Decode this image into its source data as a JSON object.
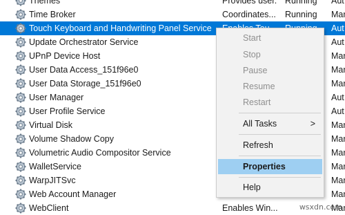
{
  "services": [
    {
      "name": "Themes",
      "description": "Provides user...",
      "status": "Running",
      "startup": "Aut"
    },
    {
      "name": "Time Broker",
      "description": "Coordinates...",
      "status": "Running",
      "startup": "Mar"
    },
    {
      "name": "Touch Keyboard and Handwriting Panel Service",
      "description": "Enables Tou...",
      "status": "Running",
      "startup": "Aut",
      "selected": true
    },
    {
      "name": "Update Orchestrator Service",
      "description": "",
      "status": "",
      "startup": "Aut"
    },
    {
      "name": "UPnP Device Host",
      "description": "",
      "status": "",
      "startup": "Mar"
    },
    {
      "name": "User Data Access_151f96e0",
      "description": "",
      "status": "",
      "startup": "Mar"
    },
    {
      "name": "User Data Storage_151f96e0",
      "description": "",
      "status": "",
      "startup": "Mar"
    },
    {
      "name": "User Manager",
      "description": "",
      "status": "",
      "startup": "Aut"
    },
    {
      "name": "User Profile Service",
      "description": "",
      "status": "",
      "startup": "Aut"
    },
    {
      "name": "Virtual Disk",
      "description": "",
      "status": "",
      "startup": "Mar"
    },
    {
      "name": "Volume Shadow Copy",
      "description": "",
      "status": "",
      "startup": "Mar"
    },
    {
      "name": "Volumetric Audio Compositor Service",
      "description": "",
      "status": "",
      "startup": "Mar"
    },
    {
      "name": "WalletService",
      "description": "",
      "status": "",
      "startup": "Mar"
    },
    {
      "name": "WarpJITSvc",
      "description": "",
      "status": "",
      "startup": "Mar"
    },
    {
      "name": "Web Account Manager",
      "description": "",
      "status": "",
      "startup": "Mar"
    },
    {
      "name": "WebClient",
      "description": "Enables Win...",
      "status": "",
      "startup": "Mar"
    }
  ],
  "context_menu": {
    "start": "Start",
    "stop": "Stop",
    "pause": "Pause",
    "resume": "Resume",
    "restart": "Restart",
    "all_tasks": "All Tasks",
    "submenu_arrow": ">",
    "refresh": "Refresh",
    "properties": "Properties",
    "help": "Help"
  },
  "icons": {
    "service": "gear-icon"
  },
  "colors": {
    "selection": "#0078d7",
    "menu_highlight": "#9ecff2"
  },
  "watermark": "wsxdn.com"
}
